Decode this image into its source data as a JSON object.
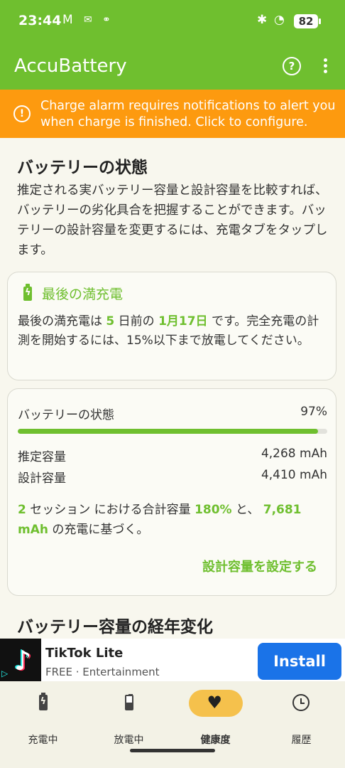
{
  "status_bar": {
    "time": "23:44",
    "battery_level": "82"
  },
  "app_bar": {
    "title": "AccuBattery"
  },
  "alert": {
    "text": "Charge alarm requires notifications to alert you when charge is finished. Click to configure."
  },
  "battery_health": {
    "heading": "バッテリーの状態",
    "description": "推定される実バッテリー容量と設計容量を比較すれば、バッテリーの劣化具合を把握することができます。バッテリーの設計容量を変更するには、充電タブをタップします。"
  },
  "last_full_charge": {
    "title": "最後の満充電",
    "text_1": "最後の満充電は ",
    "days": "5",
    "text_2": " 日前の ",
    "date": "1月17日",
    "text_3": " です。完全充電の計測を開始するには、15%以下まで放電してください。"
  },
  "health_card": {
    "health_label": "バッテリーの状態",
    "health_value": "97%",
    "health_fraction": 0.97,
    "estimated_label": "推定容量",
    "estimated_value": "4,268 mAh",
    "design_label": "設計容量",
    "design_value": "4,410 mAh",
    "sessions": "2",
    "text_1": " セッション における合計容量 ",
    "total_percent": "180%",
    "text_2": " と、 ",
    "charged_mah": "7,681 mAh",
    "text_3": " の充電に基づく。",
    "set_capacity_label": "設計容量を設定する"
  },
  "capacity_trend": {
    "heading": "バッテリー容量の経年変化"
  },
  "ad": {
    "app_name": "TikTok Lite",
    "subtitle": "FREE · Entertainment",
    "button_label": "Install"
  },
  "bottom_nav": {
    "items": [
      {
        "label": "充電中",
        "icon": "battery-charging-icon"
      },
      {
        "label": "放電中",
        "icon": "battery-discharging-icon"
      },
      {
        "label": "健康度",
        "icon": "heart-icon",
        "active": true
      },
      {
        "label": "履歴",
        "icon": "history-icon"
      }
    ]
  },
  "colors": {
    "accent": "#6fbf2f",
    "alert": "#fd9a0f",
    "install": "#1a73e8",
    "active_pill": "#f5c14c"
  }
}
